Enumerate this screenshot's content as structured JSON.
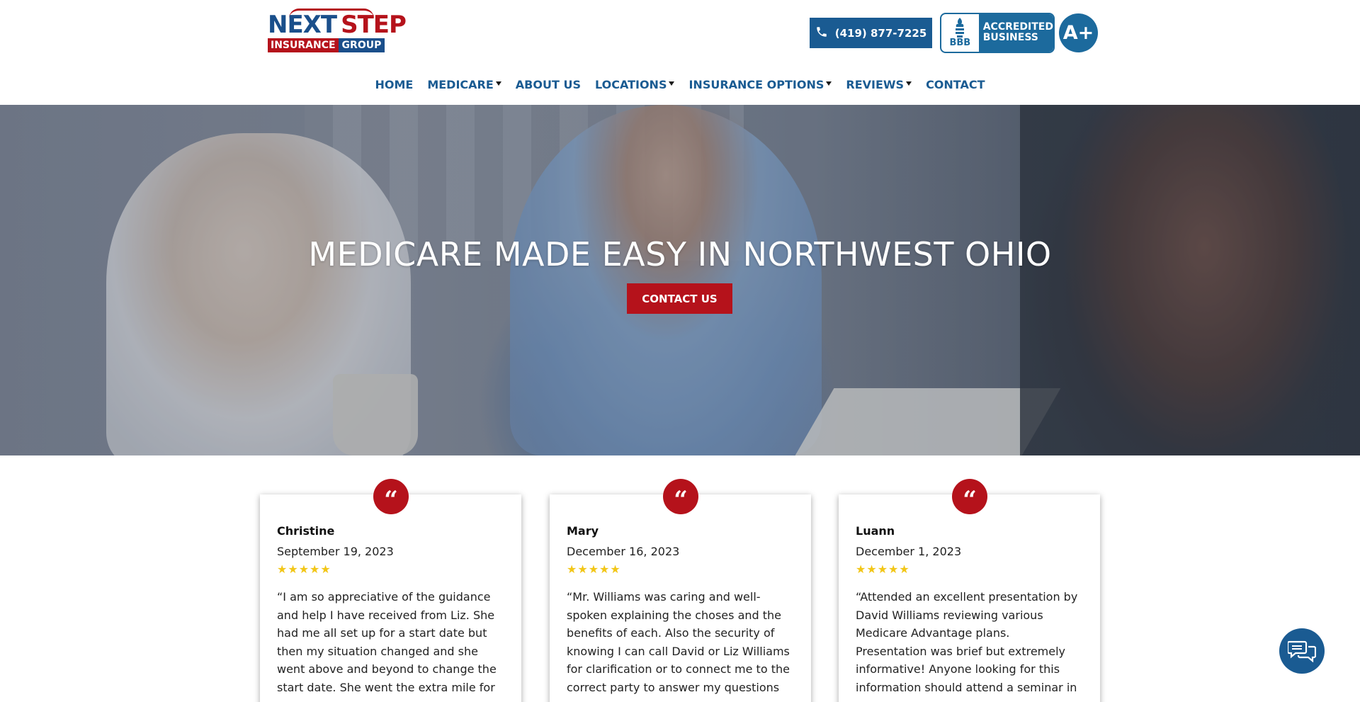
{
  "brand": {
    "logo_top_a": "NEXT",
    "logo_top_b": "STEP",
    "logo_bottom_a": "INSURANCE",
    "logo_bottom_b": "GROUP"
  },
  "header": {
    "phone_label": "(419) 877-7225",
    "bbb_mark": "BBB",
    "bbb_line1": "ACCREDITED",
    "bbb_line2": "BUSINESS",
    "bbb_rating": "A+"
  },
  "nav": {
    "items": [
      {
        "label": "HOME"
      },
      {
        "label": "MEDICARE"
      },
      {
        "label": "ABOUT US"
      },
      {
        "label": "LOCATIONS"
      },
      {
        "label": "INSURANCE OPTIONS"
      },
      {
        "label": "REVIEWS"
      },
      {
        "label": "CONTACT"
      }
    ]
  },
  "hero": {
    "title": "MEDICARE MADE EASY IN NORTHWEST OHIO",
    "cta_label": "CONTACT US"
  },
  "reviews": [
    {
      "name": "Christine",
      "date": "September 19, 2023",
      "rating": 5,
      "text": "“I am so appreciative of the guidance and help I have received from Liz. She had me all set up for a start date but then my situation changed and she went above and beyond to change the start date. She went the extra mile for"
    },
    {
      "name": "Mary",
      "date": "December 16, 2023",
      "rating": 5,
      "text": "“Mr. Williams was caring and well-spoken explaining the choses and the benefits of each. Also the security of knowing I can call David or Liz Williams for clarification or to connect me to the correct party to answer my questions"
    },
    {
      "name": "Luann",
      "date": "December 1, 2023",
      "rating": 5,
      "text": "“Attended an excellent presentation by David Williams reviewing various Medicare Advantage plans. Presentation was brief but extremely informative! Anyone looking for this information should attend a seminar in"
    }
  ],
  "colors": {
    "brand_blue": "#1a5b92",
    "brand_red": "#b5121b",
    "star_gold": "#f2c617"
  }
}
